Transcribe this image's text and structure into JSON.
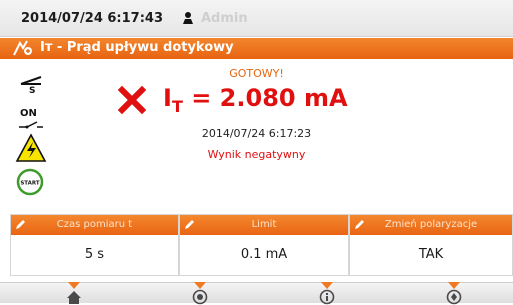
{
  "status_bar": {
    "datetime": "2014/07/24 6:17:43",
    "user_icon": "user-icon",
    "user": "Admin"
  },
  "title_bar": {
    "icon": "leakage-current-icon",
    "title": "Iᴛ - Prąd upływu dotykowy"
  },
  "side_panel": {
    "icons": [
      "switch-s-icon",
      "switch-on-icon",
      "high-voltage-warning-icon",
      "start-button-icon"
    ],
    "on_label": "ON",
    "start_label": "START"
  },
  "result": {
    "status": "GOTOWY!",
    "fail_icon": "fail-x-icon",
    "symbol": "I",
    "symbol_sub": "T",
    "value": "= 2.080 mA",
    "timestamp": "2014/07/24 6:17:23",
    "verdict": "Wynik negatywny"
  },
  "parameters": [
    {
      "label": "Czas pomiaru t",
      "value": "5 s"
    },
    {
      "label": "Limit",
      "value": "0.1 mA"
    },
    {
      "label": "Zmień polaryzacje",
      "value": "TAK"
    }
  ],
  "bottom_nav": [
    {
      "icon": "home-icon"
    },
    {
      "icon": "memory-icon"
    },
    {
      "icon": "info-icon"
    },
    {
      "icon": "settings-icon"
    }
  ],
  "colors": {
    "accent": "#e96413",
    "error": "#e01010",
    "warning_yellow": "#f7e500",
    "start_green": "#3f9a2e"
  }
}
